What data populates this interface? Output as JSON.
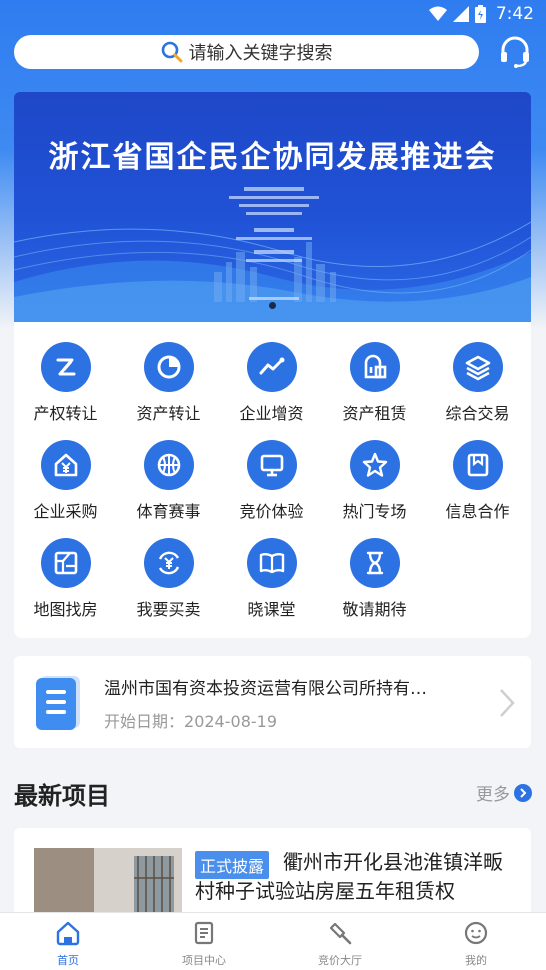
{
  "status_bar": {
    "time": "7:42"
  },
  "search": {
    "placeholder": "请输入关键字搜索"
  },
  "banner": {
    "title": "浙江省国企民企协同发展推进会"
  },
  "grid": {
    "items": [
      {
        "label": "产权转让",
        "icon": "transfer-z-icon"
      },
      {
        "label": "资产转让",
        "icon": "pie-chart-icon"
      },
      {
        "label": "企业增资",
        "icon": "trend-up-icon"
      },
      {
        "label": "资产租赁",
        "icon": "building-icon"
      },
      {
        "label": "综合交易",
        "icon": "layers-icon"
      },
      {
        "label": "企业采购",
        "icon": "house-yen-icon"
      },
      {
        "label": "体育赛事",
        "icon": "basketball-icon"
      },
      {
        "label": "竞价体验",
        "icon": "monitor-icon"
      },
      {
        "label": "热门专场",
        "icon": "star-icon"
      },
      {
        "label": "信息合作",
        "icon": "bookmark-icon"
      },
      {
        "label": "地图找房",
        "icon": "map-icon"
      },
      {
        "label": "我要买卖",
        "icon": "yen-cycle-icon"
      },
      {
        "label": "晓课堂",
        "icon": "book-icon"
      },
      {
        "label": "敬请期待",
        "icon": "hourglass-icon"
      }
    ]
  },
  "notice": {
    "title": "温州市国有资本投资运营有限公司所持有…",
    "date_label": "开始日期：",
    "date": "2024-08-19"
  },
  "latest": {
    "title": "最新项目",
    "more": "更多",
    "project": {
      "badge": "正式披露",
      "title": "衢州市开化县池淮镇洋畈村种子试验站房屋五年租赁权"
    }
  },
  "tabbar": {
    "tabs": [
      {
        "label": "首页",
        "icon": "home-icon",
        "active": true
      },
      {
        "label": "项目中心",
        "icon": "document-icon",
        "active": false
      },
      {
        "label": "竞价大厅",
        "icon": "gavel-icon",
        "active": false
      },
      {
        "label": "我的",
        "icon": "smile-icon",
        "active": false
      }
    ]
  },
  "colors": {
    "primary": "#2d72e2",
    "header_bg": "#2f7cf0",
    "page_bg": "#f2f4f7"
  }
}
